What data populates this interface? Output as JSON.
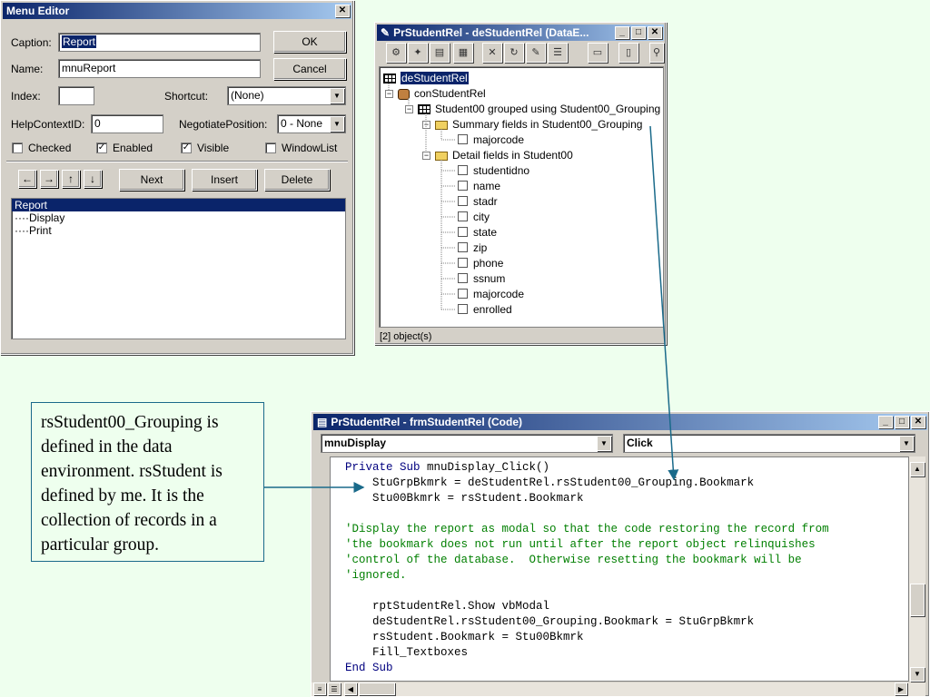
{
  "menu_editor": {
    "title": "Menu Editor",
    "caption_label": "Caption:",
    "caption_value": "Report",
    "name_label": "Name:",
    "name_value": "mnuReport",
    "index_label": "Index:",
    "index_value": "",
    "shortcut_label": "Shortcut:",
    "shortcut_value": "(None)",
    "helpcontext_label": "HelpContextID:",
    "helpcontext_value": "0",
    "negotiate_label": "NegotiatePosition:",
    "negotiate_value": "0 - None",
    "checked_label": "Checked",
    "enabled_label": "Enabled",
    "visible_label": "Visible",
    "windowlist_label": "WindowList",
    "ok_label": "OK",
    "cancel_label": "Cancel",
    "next_label": "Next",
    "insert_label": "Insert",
    "delete_label": "Delete",
    "items": [
      "Report",
      "····Display",
      "····Print"
    ]
  },
  "dataenv": {
    "title": "PrStudentRel - deStudentRel (DataE...",
    "status": "[2] object(s)",
    "tree": [
      {
        "label": "deStudentRel"
      },
      {
        "label": "conStudentRel"
      },
      {
        "label": "Student00 grouped using Student00_Grouping"
      },
      {
        "label": "Summary fields in Student00_Grouping"
      },
      {
        "label": "majorcode"
      },
      {
        "label": "Detail fields in Student00"
      },
      {
        "label": "studentidno"
      },
      {
        "label": "name"
      },
      {
        "label": "stadr"
      },
      {
        "label": "city"
      },
      {
        "label": "state"
      },
      {
        "label": "zip"
      },
      {
        "label": "phone"
      },
      {
        "label": "ssnum"
      },
      {
        "label": "majorcode"
      },
      {
        "label": "enrolled"
      }
    ]
  },
  "code_window": {
    "title": "PrStudentRel - frmStudentRel (Code)",
    "object_combo": "mnuDisplay",
    "proc_combo": "Click",
    "lines": [
      {
        "parts": [
          {
            "t": "Private Sub ",
            "c": "kw"
          },
          {
            "t": "mnuDisplay_Click()",
            "c": ""
          }
        ]
      },
      {
        "parts": [
          {
            "t": "    StuGrpBkmrk = deStudentRel.rsStudent00_Grouping.Bookmark",
            "c": ""
          }
        ]
      },
      {
        "parts": [
          {
            "t": "    Stu00Bkmrk = rsStudent.Bookmark",
            "c": ""
          }
        ]
      },
      {
        "parts": [
          {
            "t": "",
            "c": ""
          }
        ]
      },
      {
        "parts": [
          {
            "t": "'Display the report as modal so that the code restoring the record from",
            "c": "cm"
          }
        ]
      },
      {
        "parts": [
          {
            "t": "'the bookmark does not run until after the report object relinquishes",
            "c": "cm"
          }
        ]
      },
      {
        "parts": [
          {
            "t": "'control of the database.  Otherwise resetting the bookmark will be",
            "c": "cm"
          }
        ]
      },
      {
        "parts": [
          {
            "t": "'ignored.",
            "c": "cm"
          }
        ]
      },
      {
        "parts": [
          {
            "t": "",
            "c": ""
          }
        ]
      },
      {
        "parts": [
          {
            "t": "    rptStudentRel.Show vbModal",
            "c": ""
          }
        ]
      },
      {
        "parts": [
          {
            "t": "    deStudentRel.rsStudent00_Grouping.Bookmark = StuGrpBkmrk",
            "c": ""
          }
        ]
      },
      {
        "parts": [
          {
            "t": "    rsStudent.Bookmark = Stu00Bkmrk",
            "c": ""
          }
        ]
      },
      {
        "parts": [
          {
            "t": "    Fill_Textboxes",
            "c": ""
          }
        ]
      },
      {
        "parts": [
          {
            "t": "End Sub",
            "c": "kw"
          }
        ]
      }
    ]
  },
  "note": {
    "text": "rsStudent00_Grouping is defined in the data environment.  rsStudent is defined by me.  It is the collection of records in a particular group."
  }
}
